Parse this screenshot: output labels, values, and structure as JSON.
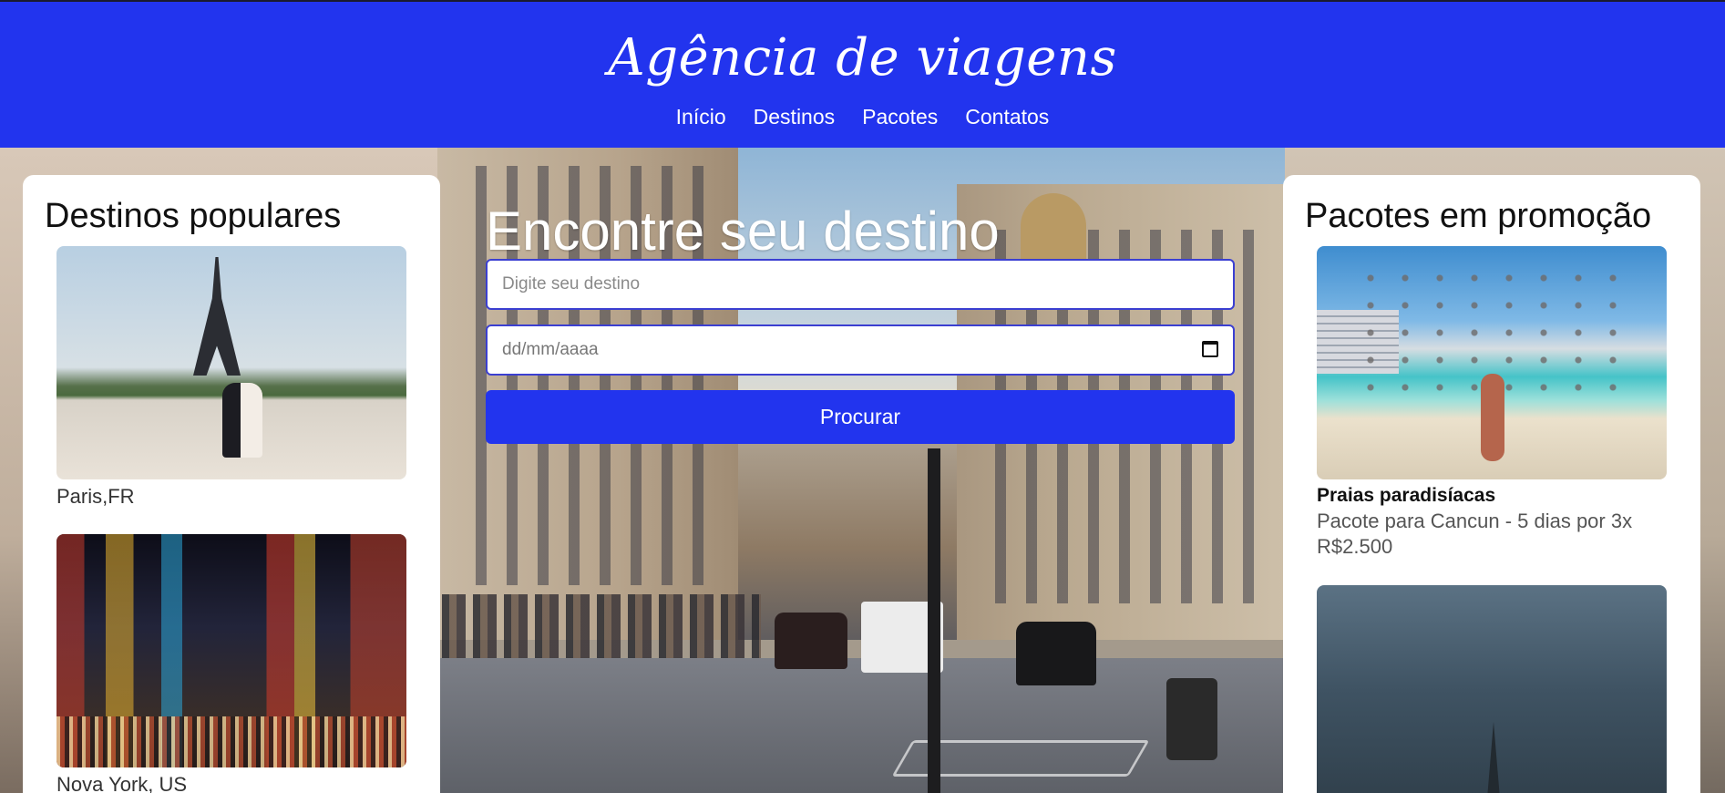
{
  "header": {
    "brand": "Agência de viagens",
    "nav": [
      {
        "label": "Início"
      },
      {
        "label": "Destinos"
      },
      {
        "label": "Pacotes"
      },
      {
        "label": "Contatos"
      }
    ]
  },
  "search": {
    "title": "Encontre seu destino",
    "destination_placeholder": "Digite seu destino",
    "date_placeholder": "dd/mm/aaaa",
    "button_label": "Procurar"
  },
  "popular": {
    "title": "Destinos populares",
    "items": [
      {
        "caption": "Paris,FR"
      },
      {
        "caption": "Nova York, US"
      }
    ]
  },
  "promotions": {
    "title": "Pacotes em promoção",
    "items": [
      {
        "title": "Praias paradisíacas",
        "description": "Pacote para Cancun - 5 dias por 3x R$2.500"
      },
      {
        "title": "",
        "description": ""
      }
    ]
  },
  "colors": {
    "brand_blue": "#2234ee",
    "panel_bg": "#ffffff"
  },
  "icons": {
    "date_picker": "calendar-icon"
  }
}
